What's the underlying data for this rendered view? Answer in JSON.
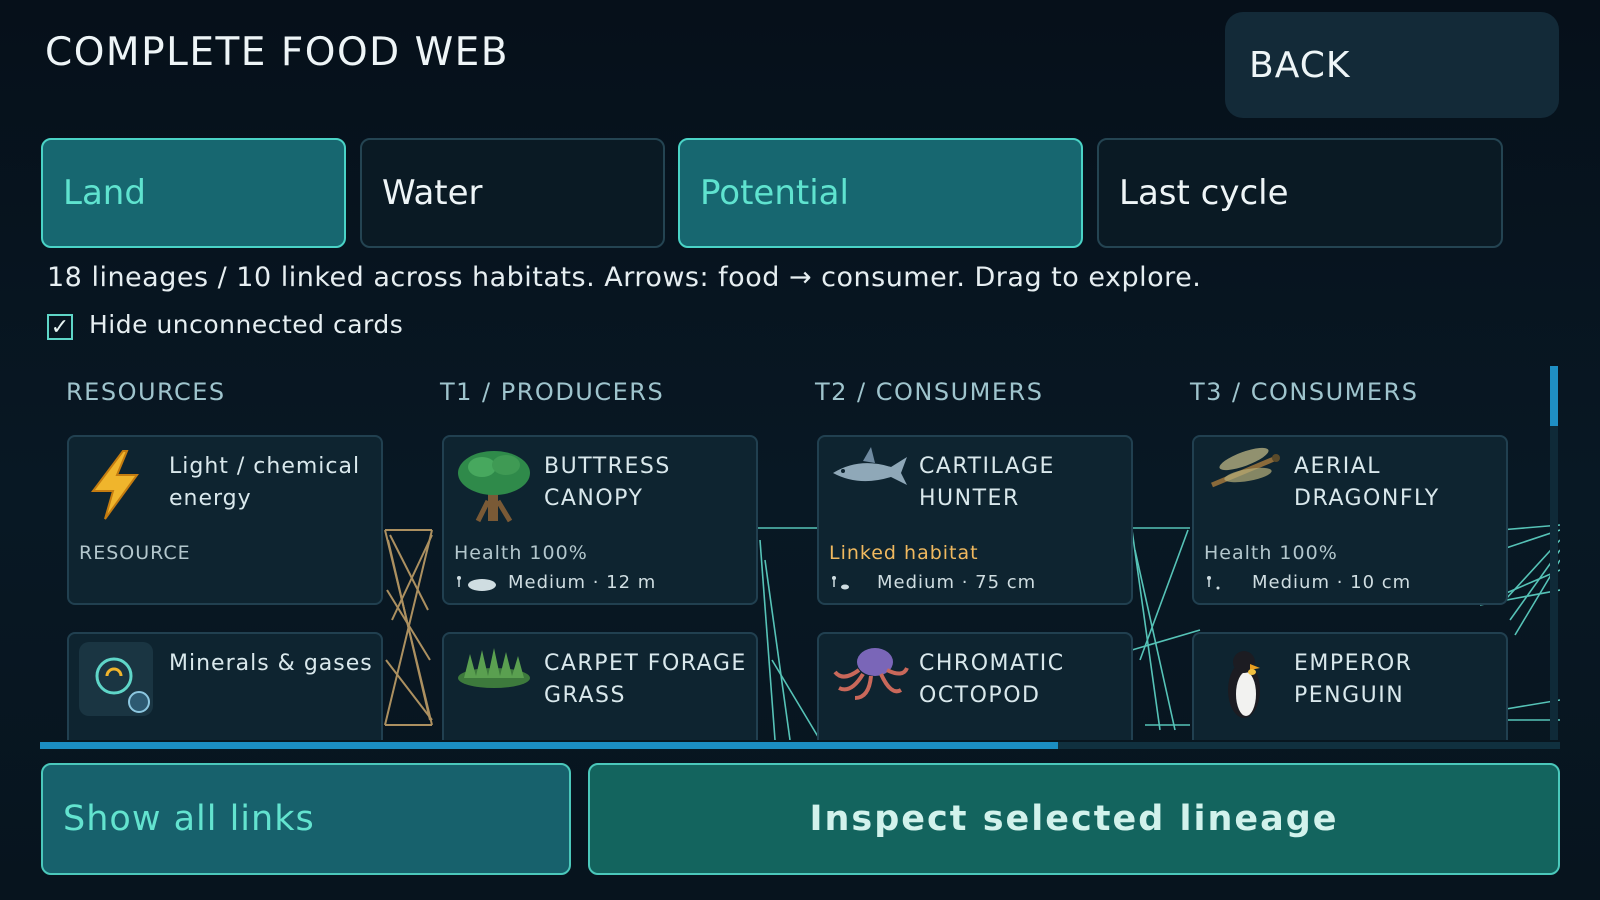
{
  "header": {
    "title": "COMPLETE FOOD WEB",
    "back_label": "BACK"
  },
  "tabs": [
    {
      "label": "Land",
      "active": true
    },
    {
      "label": "Water",
      "active": false
    },
    {
      "label": "Potential",
      "active": true
    },
    {
      "label": "Last cycle",
      "active": false
    }
  ],
  "info_text": "18 lineages / 10 linked across habitats. Arrows: food → consumer. Drag to explore.",
  "hide_unconnected": {
    "label": "Hide unconnected cards",
    "checked": true
  },
  "columns": [
    "RESOURCES",
    "T1 / PRODUCERS",
    "T2 / CONSUMERS",
    "T3 / CONSUMERS"
  ],
  "cards": {
    "light": {
      "name_1": "Light / chemical",
      "name_2": "energy",
      "sub": "RESOURCE",
      "icon": "lightning-icon"
    },
    "minerals": {
      "name_1": "Minerals & gases",
      "icon": "minerals-icon"
    },
    "buttress": {
      "name_1": "BUTTRESS",
      "name_2": "CANOPY",
      "sub": "Health 100%",
      "meta": "Medium · 12 m",
      "icon": "tree-icon"
    },
    "carpet": {
      "name_1": "CARPET FORAGE",
      "name_2": "GRASS",
      "icon": "grass-icon"
    },
    "cartilage": {
      "name_1": "CARTILAGE",
      "name_2": "HUNTER",
      "sub": "Linked habitat",
      "meta": "Medium · 75 cm",
      "icon": "shark-icon"
    },
    "octopod": {
      "name_1": "CHROMATIC",
      "name_2": "OCTOPOD",
      "icon": "octopus-icon"
    },
    "dragonfly": {
      "name_1": "AERIAL",
      "name_2": "DRAGONFLY",
      "sub": "Health 100%",
      "meta": "Medium · 10 cm",
      "icon": "dragonfly-icon"
    },
    "penguin": {
      "name_1": "EMPEROR",
      "name_2": "PENGUIN",
      "icon": "penguin-icon"
    }
  },
  "buttons": {
    "show_all": "Show all links",
    "inspect": "Inspect selected lineage"
  },
  "colors": {
    "accent": "#4ad3c6",
    "tab_active": "#176770",
    "link_line": "#5fd6c8",
    "resource_arrow": "#c9a66b",
    "warning": "#f0b95f"
  },
  "scroll": {
    "horizontal_fraction": 0.67,
    "vertical_fraction": 0.16
  }
}
